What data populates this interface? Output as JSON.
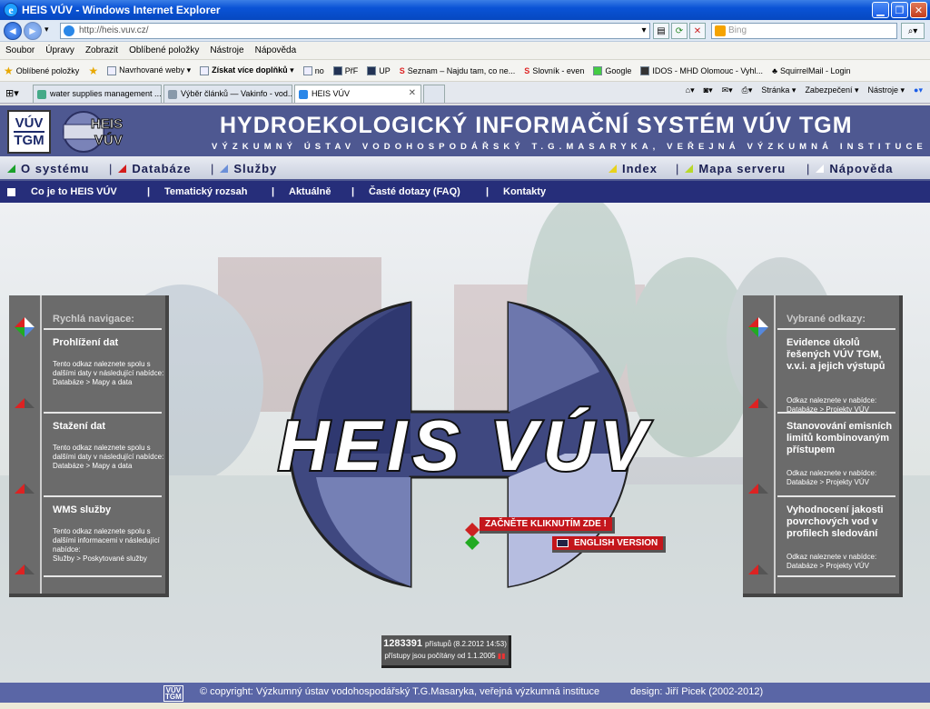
{
  "browser": {
    "window_title": "HEIS VÚV - Windows Internet Explorer",
    "address": "http://heis.vuv.cz/",
    "search_placeholder": "Bing",
    "menu": [
      "Soubor",
      "Úpravy",
      "Zobrazit",
      "Oblíbené položky",
      "Nástroje",
      "Nápověda"
    ],
    "favorites_label": "Oblíbené položky",
    "favorites": [
      "Navrhované weby ▾",
      "Získat více doplňků ▾",
      "no",
      "PřF",
      "UP",
      "Seznam – Najdu tam, co ne...",
      "Slovník - even",
      "Google",
      "IDOS - MHD Olomouc - Vyhl...",
      "SquirrelMail - Login"
    ],
    "tabs": [
      "water supplies management ...",
      "Výběr článků — Vakinfo - vod...",
      "HEIS VÚV"
    ],
    "tools": [
      "Stránka ▾",
      "Zabezpečení ▾",
      "Nástroje ▾"
    ]
  },
  "header": {
    "logo_line1": "VÚV",
    "logo_line2": "TGM",
    "logo_heis": "HEIS",
    "logo_vuv": "VÚV",
    "title": "HYDROEKOLOGICKÝ INFORMAČNÍ SYSTÉM VÚV TGM",
    "subtitle": "VÝZKUMNÝ ÚSTAV VODOHOSPODÁŘSKÝ T.G.MASARYKA, VEŘEJNÁ VÝZKUMNÁ INSTITUCE"
  },
  "mainnav": {
    "left": [
      "O systému",
      "Databáze",
      "Služby"
    ],
    "right": [
      "Index",
      "Mapa serveru",
      "Nápověda"
    ]
  },
  "subnav": [
    "Co je to HEIS VÚV",
    "Tematický rozsah",
    "Aktuálně",
    "Časté dotazy (FAQ)",
    "Kontakty"
  ],
  "left_panel": {
    "heading": "Rychlá navigace:",
    "items": [
      {
        "title": "Prohlížení dat",
        "desc": "Tento odkaz naleznete spolu s dalšími daty v následující nabídce:",
        "path": "Databáze > Mapy a data"
      },
      {
        "title": "Stažení dat",
        "desc": "Tento odkaz naleznete spolu s dalšími daty v následující nabídce:",
        "path": "Databáze > Mapy a data"
      },
      {
        "title": "WMS služby",
        "desc": "Tento odkaz naleznete spolu s dalšími informacemi v následující nabídce:",
        "path": "Služby > Poskytované služby"
      }
    ]
  },
  "right_panel": {
    "heading": "Vybrané odkazy:",
    "items": [
      {
        "title": "Evidence úkolů řešených VÚV TGM, v.v.i. a jejich výstupů",
        "desc": "Odkaz naleznete v nabídce:",
        "path": "Databáze > Projekty VÚV"
      },
      {
        "title": "Stanovování emisních limitů kombinovaným přístupem",
        "desc": "Odkaz naleznete v nabídce:",
        "path": "Databáze > Projekty VÚV"
      },
      {
        "title": "Vyhodnocení jakosti povrchových vod v profilech sledování",
        "desc": "Odkaz naleznete v nabídce:",
        "path": "Databáze > Projekty VÚV"
      }
    ]
  },
  "center": {
    "logo_text": "HEIS VÚV",
    "start_button": "ZAČNĚTE KLIKNUTÍM ZDE !",
    "english_button": "ENGLISH VERSION"
  },
  "counter": {
    "count": "1283391",
    "count_suffix": "přístupů (8.2.2012 14:53)",
    "since": "přístupy jsou počítány od 1.1.2005"
  },
  "footer": {
    "logo_l1": "VÚV",
    "logo_l2": "TGM",
    "copyright": "© copyright: Výzkumný ústav vodohospodářský T.G.Masaryka, veřejná výzkumná instituce",
    "design": "design: Jiří Picek (2002-2012)"
  },
  "colors": {
    "header_bg": "#4e5891",
    "subnav_bg": "#262e7a",
    "accent_red": "#c4161c",
    "panel_gray": "#6b6b6b"
  }
}
